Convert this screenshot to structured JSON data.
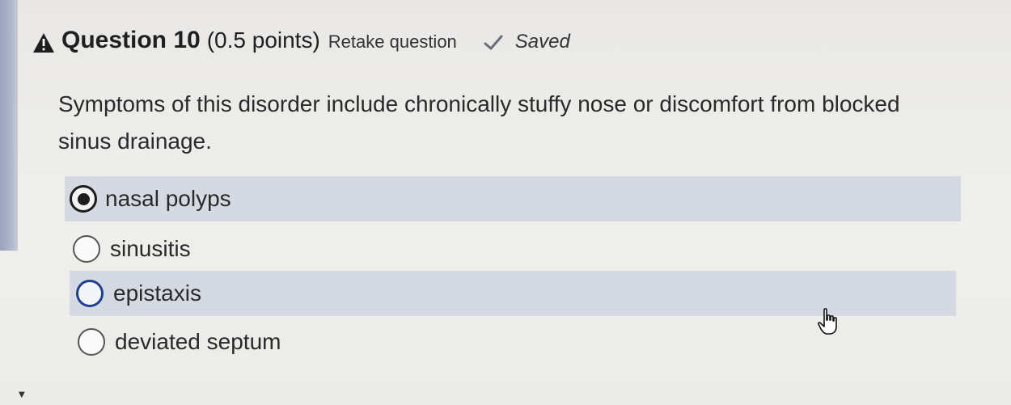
{
  "question": {
    "title": "Question 10",
    "points": "(0.5 points)",
    "retake_label": "Retake question",
    "saved_label": "Saved",
    "text": "Symptoms of this disorder include chronically stuffy nose or discomfort from blocked sinus drainage.",
    "warning_icon": "warning-triangle-icon",
    "saved_icon": "checkmark-icon"
  },
  "options": [
    {
      "label": "nasal polyps",
      "selected": true
    },
    {
      "label": "sinusitis",
      "selected": false
    },
    {
      "label": "epistaxis",
      "selected": false
    },
    {
      "label": "deviated septum",
      "selected": false
    }
  ],
  "colors": {
    "highlight_row": "#d5dae2",
    "focus_ring": "#1f3f8f",
    "left_bar": "#9aa3bd"
  }
}
